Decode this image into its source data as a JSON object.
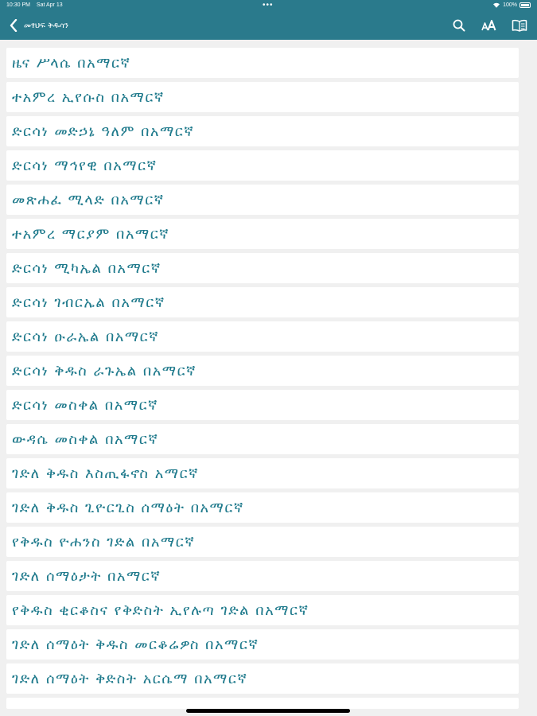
{
  "status_bar": {
    "time": "10:30 PM",
    "date": "Sat Apr 13",
    "dots": "•••",
    "battery": "100%"
  },
  "header": {
    "title": "መፃህፍ ቅዱሳን",
    "back_icon": "chevron-left-icon",
    "actions": [
      {
        "icon": "search-icon"
      },
      {
        "icon": "text-size-icon"
      },
      {
        "icon": "book-icon"
      }
    ],
    "bar_color": "#2a7a8c"
  },
  "list": {
    "text_color": "#1f7a8c",
    "items": [
      "ዜና ሥላሴ በአማርኛ",
      "ተአምረ ኢየሱስ በአማርኛ",
      "ድርሳነ መድኃኔ ዓለም በአማርኛ",
      "ድርሳነ ማኅየዊ በአማርኛ",
      "መጽሐፈ ሚላድ በአማርኛ",
      "ተአምረ ማርያም በአማርኛ",
      "ድርሳነ ሚካኤል በአማርኛ",
      "ድርሳነ ገብርኤል በአማርኛ",
      "ድርሳነ ዑራኤል በአማርኛ",
      "ድርሳነ ቅዱስ ራጉኤል በአማርኛ",
      "ድርሳነ መስቀል በአማርኛ",
      "ውዳሴ መስቀል በአማርኛ",
      "ገድለ ቅዱስ እስጢፋኖስ አማርኛ",
      "ገድለ ቅዱስ ጊዮርጊስ ሰማዕት በአማርኛ",
      "የቅዱስ ዮሐንስ ገድል በአማርኛ",
      "ገድለ ሰማዕታት በአማርኛ",
      "የቅዱስ ቂርቆስና የቅድስት ኢየሉጣ ገድል በአማርኛ",
      "ገድለ ሰማዕት ቅዱስ መርቆሬዎስ በአማርኛ",
      "ገድለ ሰማዕት ቅድስት አርሴማ በአማርኛ"
    ]
  }
}
